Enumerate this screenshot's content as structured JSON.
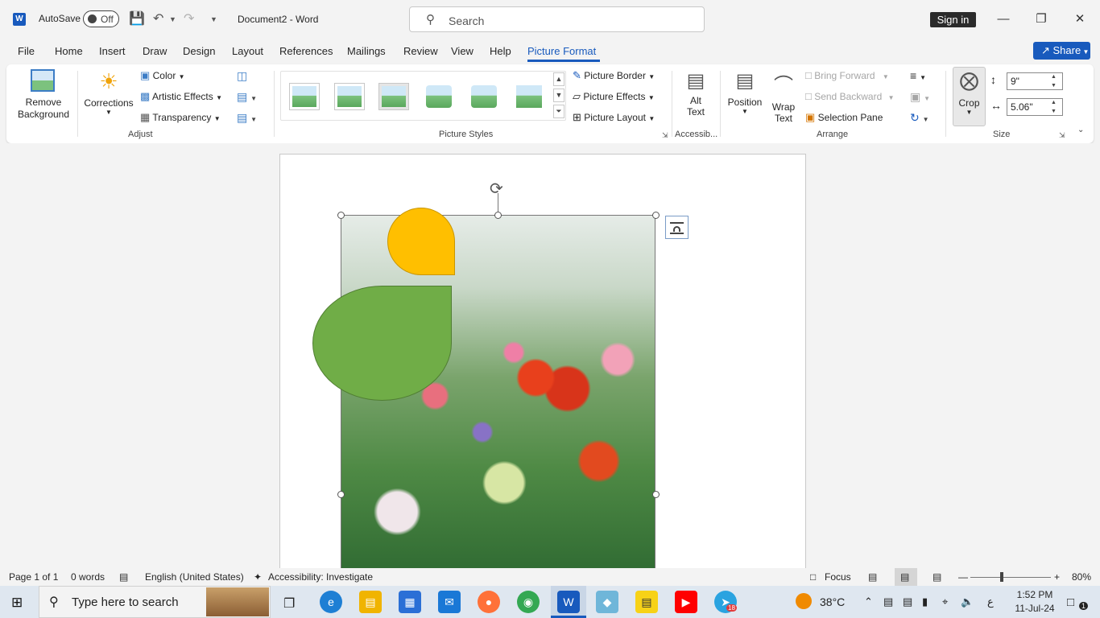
{
  "titlebar": {
    "app_logo": "W",
    "autosave_label": "AutoSave",
    "autosave_state": "Off",
    "doc_title": "Document2  -  Word",
    "search_placeholder": "Search",
    "signin_label": "Sign in"
  },
  "tabs": [
    "File",
    "Home",
    "Insert",
    "Draw",
    "Design",
    "Layout",
    "References",
    "Mailings",
    "Review",
    "View",
    "Help",
    "Picture Format"
  ],
  "share_label": "Share",
  "ribbon": {
    "adjust": {
      "remove_background": [
        "Remove",
        "Background"
      ],
      "corrections": "Corrections",
      "color": "Color",
      "artistic_effects": "Artistic Effects",
      "transparency": "Transparency",
      "group_label": "Adjust"
    },
    "picture_styles": {
      "group_label": "Picture Styles",
      "picture_border": "Picture Border",
      "picture_effects": "Picture Effects",
      "picture_layout": "Picture Layout"
    },
    "accessibility": {
      "alt_text": [
        "Alt",
        "Text"
      ],
      "group_label": "Accessib..."
    },
    "arrange": {
      "position": "Position",
      "wrap_text": [
        "Wrap",
        "Text"
      ],
      "bring_forward": "Bring Forward",
      "send_backward": "Send Backward",
      "selection_pane": "Selection Pane",
      "group_label": "Arrange"
    },
    "size": {
      "crop": "Crop",
      "height": "9\"",
      "width": "5.06\"",
      "group_label": "Size"
    }
  },
  "statusbar": {
    "page": "Page 1 of 1",
    "words": "0 words",
    "language": "English (United States)",
    "accessibility": "Accessibility: Investigate",
    "focus": "Focus",
    "zoom": "80%"
  },
  "taskbar": {
    "search_placeholder": "Type here to search",
    "weather": "38°C",
    "time": "1:52 PM",
    "date": "11-Jul-24",
    "lang": "ع",
    "notification_count": "1",
    "telegram_badge": "18"
  },
  "colors": {
    "accent": "#185abd",
    "shape_yellow": "#ffbf00",
    "shape_green": "#70ad47"
  }
}
